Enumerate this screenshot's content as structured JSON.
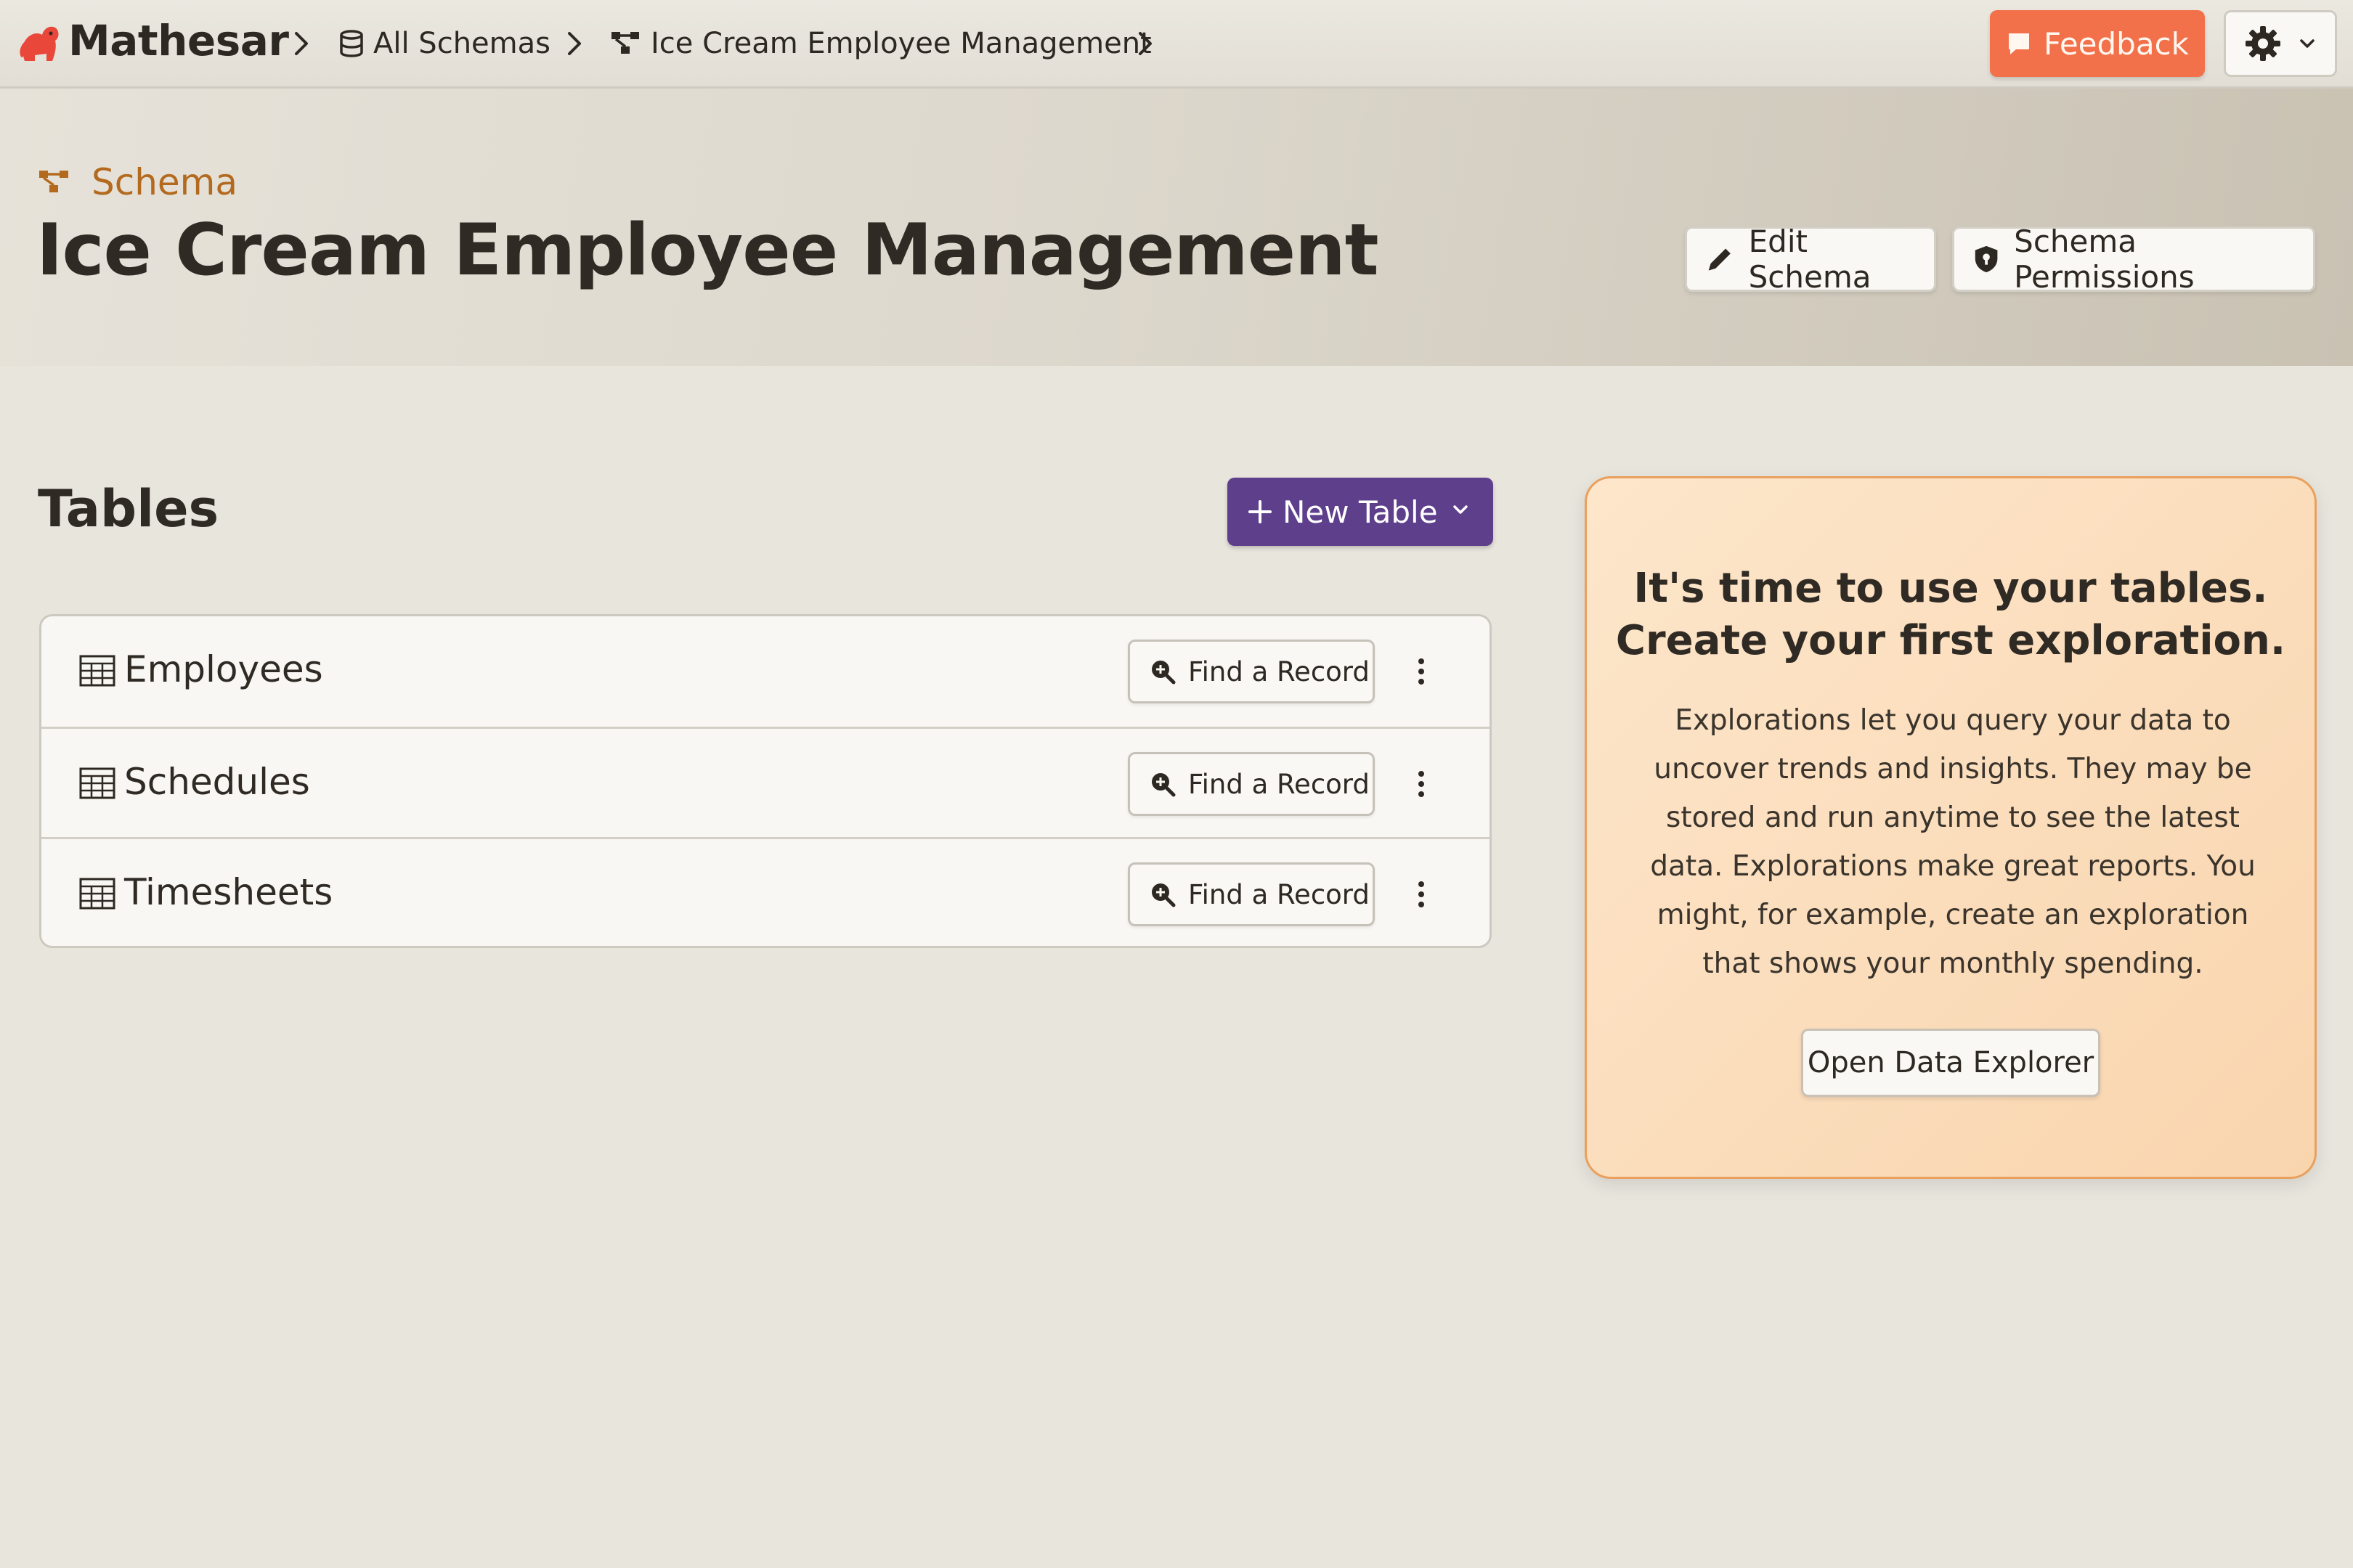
{
  "app": {
    "name": "Mathesar"
  },
  "breadcrumb": {
    "all_schemas": "All Schemas",
    "schema": "Ice Cream Employee Management"
  },
  "topbar": {
    "feedback_label": "Feedback"
  },
  "header": {
    "kicker": "Schema",
    "title": "Ice Cream Employee Management",
    "edit_label": "Edit Schema",
    "permissions_label": "Schema Permissions"
  },
  "tables_section": {
    "title": "Tables",
    "new_table_label": "New Table",
    "find_label": "Find a Record",
    "items": [
      {
        "name": "Employees"
      },
      {
        "name": "Schedules"
      },
      {
        "name": "Timesheets"
      }
    ]
  },
  "explore_card": {
    "title_line1": "It's time to use your tables.",
    "title_line2": "Create your first exploration.",
    "body": "Explorations let you query your data to uncover trends and insights. They may be stored and run anytime to see the latest data. Explorations make great reports. You might, for example, create an exploration that shows your monthly spending.",
    "button_label": "Open Data Explorer"
  },
  "colors": {
    "accent_purple": "#5e3f8c",
    "feedback_orange": "#f2704a",
    "schema_brown": "#b36a1e",
    "card_bg": "#fde6cb"
  },
  "icons": {
    "logo": "elephant-logo-icon",
    "database": "database-icon",
    "schema": "schema-icon",
    "chevron": "chevron-right-icon",
    "feedback": "speech-bubble-icon",
    "settings": "gear-icon",
    "edit": "pencil-icon",
    "permissions": "shield-icon",
    "table": "table-grid-icon",
    "find": "search-plus-icon",
    "more": "kebab-icon"
  }
}
